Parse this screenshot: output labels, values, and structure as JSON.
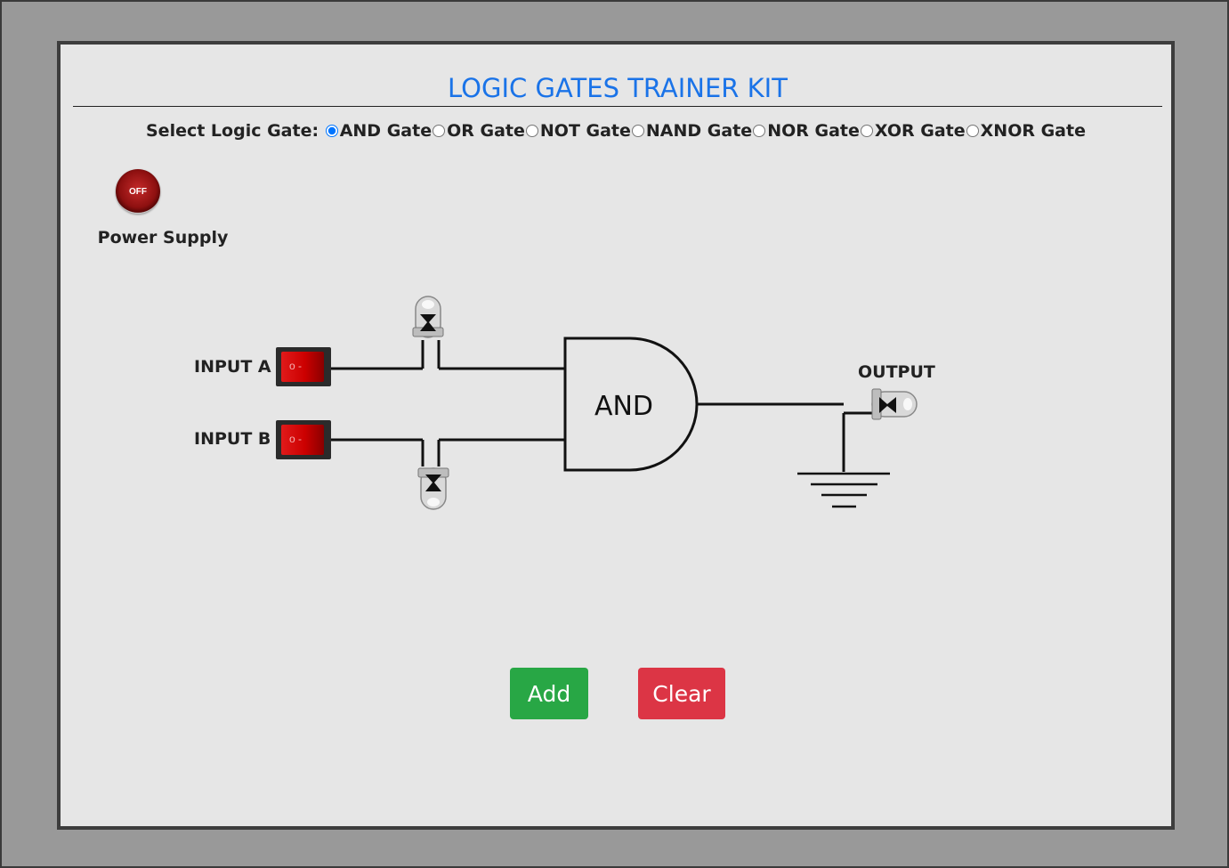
{
  "title": "LOGIC GATES TRAINER KIT",
  "gate_selector": {
    "label": "Select Logic Gate:",
    "options": [
      "AND Gate",
      "OR Gate",
      "NOT Gate",
      "NAND Gate",
      "NOR Gate",
      "XOR Gate",
      "XNOR Gate"
    ],
    "selected": "AND Gate"
  },
  "power": {
    "button_text": "OFF",
    "label": "Power Supply"
  },
  "inputs": {
    "a_label": "INPUT A",
    "b_label": "INPUT B"
  },
  "gate_symbol_text": "AND",
  "output_label": "OUTPUT",
  "buttons": {
    "add": "Add",
    "clear": "Clear"
  },
  "colors": {
    "title": "#1a73e8",
    "add_button": "#28a745",
    "clear_button": "#dc3545",
    "switch": "#cc0000",
    "background": "#999999",
    "panel": "#e6e6e6"
  },
  "icons": [
    "power-off-icon",
    "rocker-switch-icon",
    "led-icon",
    "and-gate-icon",
    "ground-icon"
  ]
}
